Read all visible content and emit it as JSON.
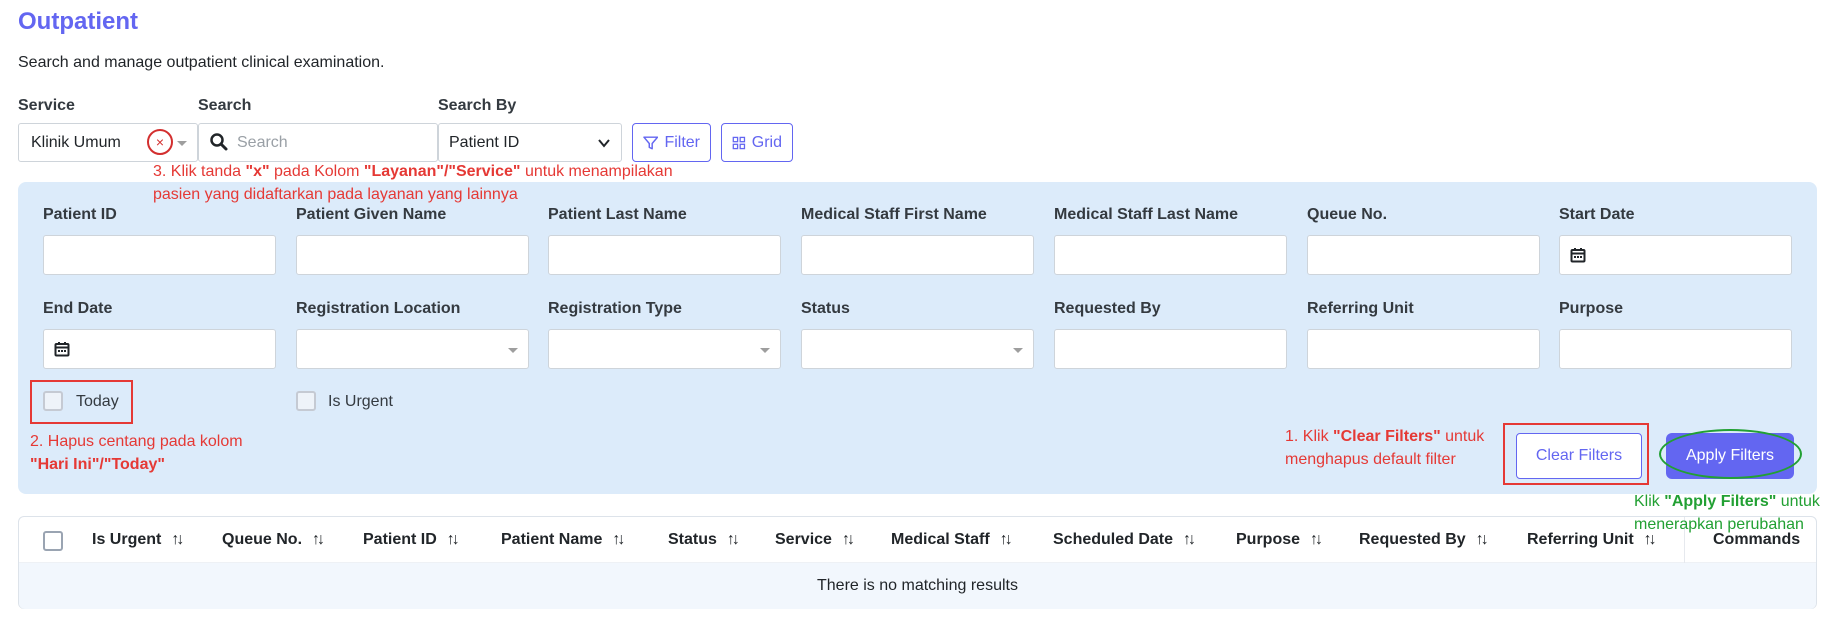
{
  "page": {
    "title": "Outpatient",
    "description": "Search and manage outpatient clinical examination."
  },
  "top_filters": {
    "service_label": "Service",
    "service_value": "Klinik Umum",
    "clear_symbol": "×",
    "search_label": "Search",
    "search_placeholder": "Search",
    "search_by_label": "Search By",
    "search_by_value": "Patient ID",
    "filter_button": "Filter",
    "grid_button": "Grid"
  },
  "filter_panel": {
    "row1": [
      {
        "label": "Patient ID"
      },
      {
        "label": "Patient Given Name"
      },
      {
        "label": "Patient Last Name"
      },
      {
        "label": "Medical Staff First Name"
      },
      {
        "label": "Medical Staff Last Name"
      },
      {
        "label": "Queue No."
      },
      {
        "label": "Start Date"
      }
    ],
    "row2": [
      {
        "label": "End Date"
      },
      {
        "label": "Registration Location"
      },
      {
        "label": "Registration Type"
      },
      {
        "label": "Status"
      },
      {
        "label": "Requested By"
      },
      {
        "label": "Referring Unit"
      },
      {
        "label": "Purpose"
      }
    ],
    "today_label": "Today",
    "today_checked": false,
    "urgent_label": "Is Urgent",
    "urgent_checked": false,
    "clear_filters": "Clear Filters",
    "apply_filters": "Apply Filters"
  },
  "annotations": {
    "step3_prefix": "3. Klik tanda ",
    "step3_x": "\"x\"",
    "step3_mid": " pada Kolom ",
    "step3_col": "\"Layanan\"/\"Service\"",
    "step3_suffix": " untuk menampilakan",
    "step3_line2": "pasien yang didaftarkan pada layanan yang lainnya",
    "step2_line1": "2. Hapus centang pada kolom",
    "step2_line2": "\"Hari Ini\"/\"Today\"",
    "step1_prefix": "1. Klik ",
    "step1_bold": "\"Clear Filters\"",
    "step1_suffix": " untuk",
    "step1_line2": "menghapus default filter",
    "apply_prefix": "Klik ",
    "apply_bold": "\"Apply Filters\"",
    "apply_suffix": " untuk",
    "apply_line2": "menerapkan perubahan",
    "colors": {
      "red": "#e53935",
      "green": "#22a033"
    }
  },
  "table": {
    "columns": [
      "Is Urgent",
      "Queue No.",
      "Patient ID",
      "Patient Name",
      "Status",
      "Service",
      "Medical Staff",
      "Scheduled Date",
      "Purpose",
      "Requested By",
      "Referring Unit"
    ],
    "commands_label": "Commands",
    "empty_message": "There is no matching results"
  },
  "colors": {
    "accent": "#6366f1",
    "panel_bg": "#dcebfa"
  }
}
